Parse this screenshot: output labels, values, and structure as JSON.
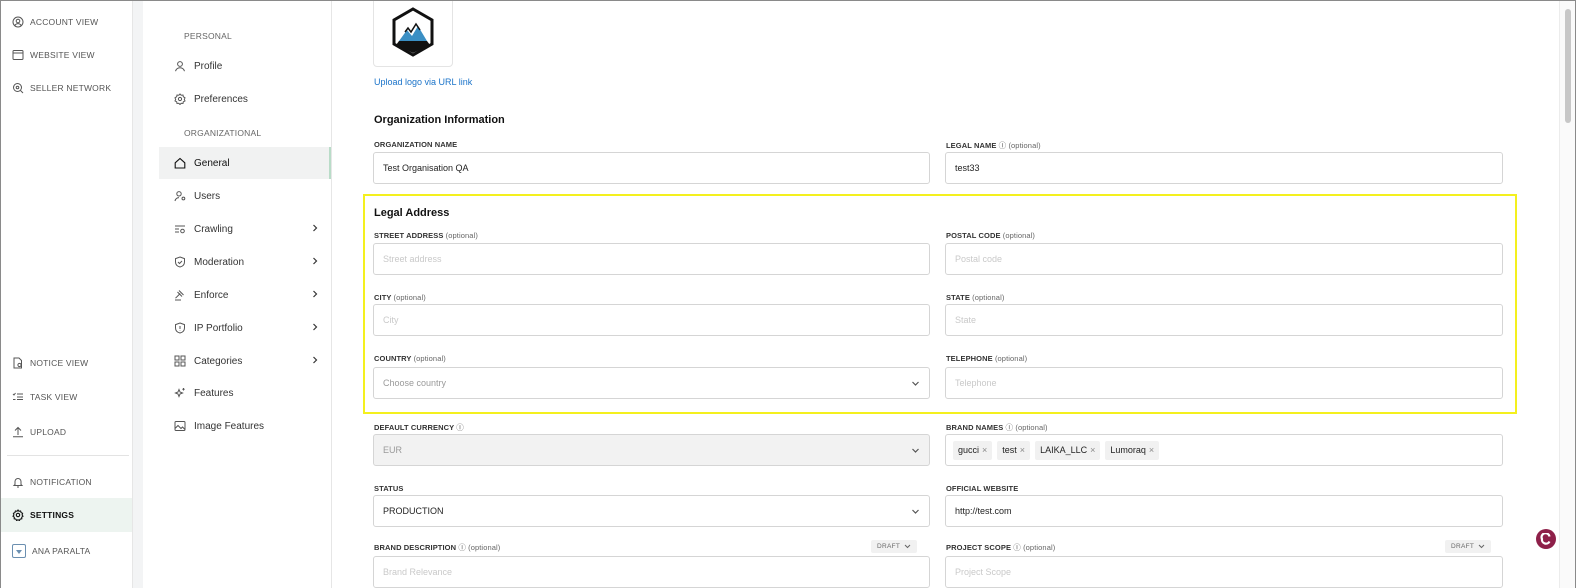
{
  "rail": {
    "items": [
      {
        "label": "ACCOUNT VIEW",
        "icon": "user-circle-icon"
      },
      {
        "label": "WEBSITE VIEW",
        "icon": "browser-window-icon"
      },
      {
        "label": "SELLER NETWORK",
        "icon": "network-search-icon"
      },
      {
        "label": "NOTICE VIEW",
        "icon": "document-search-icon"
      },
      {
        "label": "TASK VIEW",
        "icon": "task-list-icon"
      },
      {
        "label": "UPLOAD",
        "icon": "upload-icon"
      },
      {
        "label": "NOTIFICATION",
        "icon": "bell-icon"
      },
      {
        "label": "SETTINGS",
        "icon": "gear-icon"
      },
      {
        "label": "ANA PARALTA",
        "icon": "avatar-icon"
      }
    ]
  },
  "menu": {
    "personal_label": "PERSONAL",
    "organizational_label": "ORGANIZATIONAL",
    "items": [
      {
        "label": "Profile"
      },
      {
        "label": "Preferences"
      },
      {
        "label": "General"
      },
      {
        "label": "Users"
      },
      {
        "label": "Crawling"
      },
      {
        "label": "Moderation"
      },
      {
        "label": "Enforce"
      },
      {
        "label": "IP Portfolio"
      },
      {
        "label": "Categories"
      },
      {
        "label": "Features"
      },
      {
        "label": "Image Features"
      }
    ]
  },
  "main": {
    "upload_logo_link": "Upload logo via URL link",
    "org_info_heading": "Organization Information",
    "org_name_label": "ORGANIZATION NAME",
    "org_name_value": "Test Organisation QA",
    "legal_name_label": "LEGAL NAME",
    "legal_name_value": "test33",
    "optional": "(optional)",
    "legal_address_heading": "Legal Address",
    "street_label": "STREET ADDRESS",
    "street_placeholder": "Street address",
    "postal_label": "POSTAL CODE",
    "postal_placeholder": "Postal code",
    "city_label": "CITY",
    "city_placeholder": "City",
    "state_label": "STATE",
    "state_placeholder": "State",
    "country_label": "COUNTRY",
    "country_placeholder": "Choose country",
    "telephone_label": "TELEPHONE",
    "telephone_placeholder": "Telephone",
    "currency_label": "DEFAULT CURRENCY",
    "currency_value": "EUR",
    "brand_names_label": "BRAND NAMES",
    "brand_names": [
      "gucci",
      "test",
      "LAIKA_LLC",
      "Lumoraq"
    ],
    "status_label": "STATUS",
    "status_value": "PRODUCTION",
    "website_label": "OFFICIAL WEBSITE",
    "website_value": "http://test.com",
    "brand_desc_label": "BRAND DESCRIPTION",
    "brand_desc_placeholder": "Brand Relevance",
    "project_scope_label": "PROJECT SCOPE",
    "project_scope_placeholder": "Project Scope",
    "draft_label": "DRAFT"
  },
  "colors": {
    "highlight": "#f4f01e",
    "link": "#1a73c9",
    "fab": "#8e2049"
  }
}
